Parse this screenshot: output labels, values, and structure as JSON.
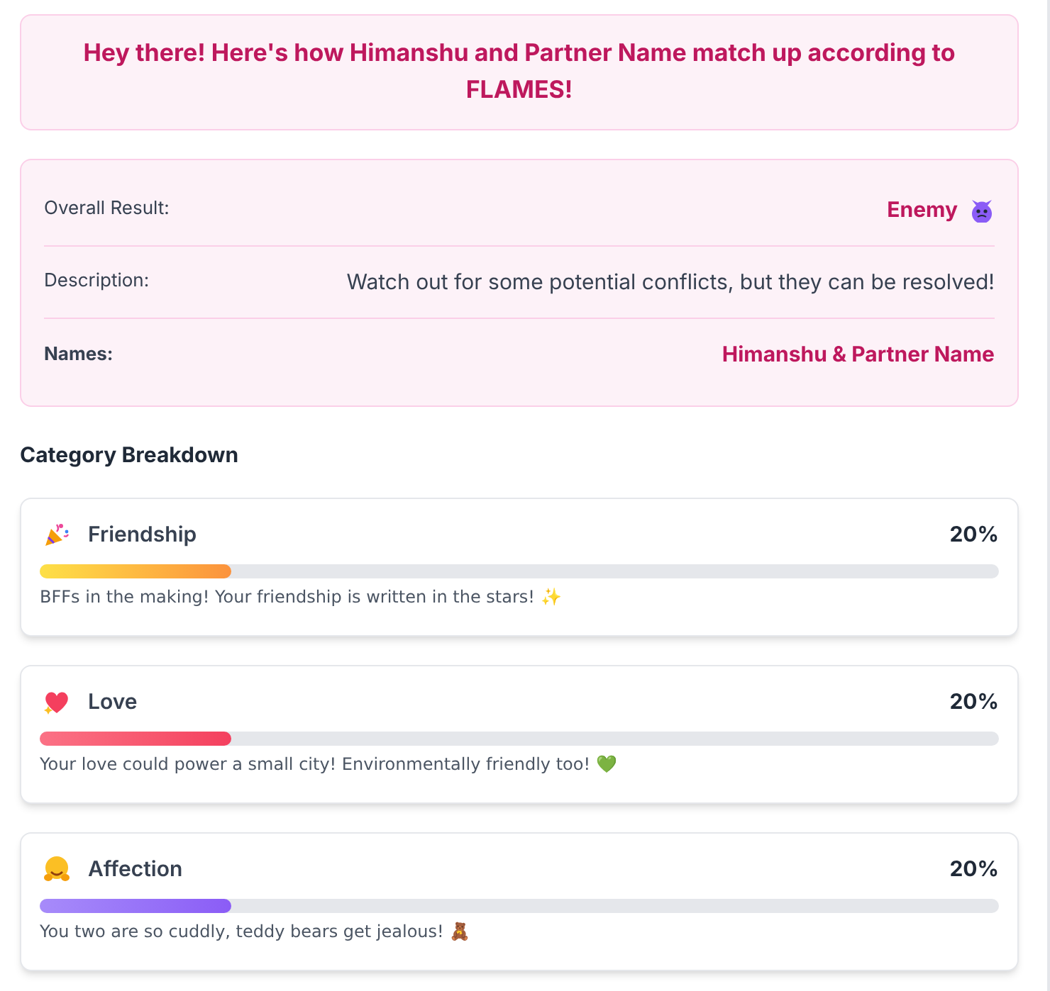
{
  "header": {
    "title": "Hey there! Here's how Himanshu and Partner Name match up according to FLAMES!"
  },
  "summary": {
    "rows": [
      {
        "kind": "result",
        "label": "Overall Result:",
        "value": "Enemy"
      },
      {
        "kind": "text",
        "label": "Description:",
        "value": "Watch out for some potential conflicts, but they can be resolved!"
      },
      {
        "kind": "names",
        "label": "Names:",
        "value": "Himanshu & Partner Name"
      }
    ]
  },
  "breakdown": {
    "heading": "Category Breakdown",
    "categories": [
      {
        "kind": "friendship",
        "name": "Friendship",
        "percent": "20%",
        "level": 0.2,
        "note": "BFFs in the making! Your friendship is written in the stars! ✨"
      },
      {
        "kind": "love",
        "name": "Love",
        "percent": "20%",
        "level": 0.2,
        "note": "Your love could power a small city! Environmentally friendly too! 💚"
      },
      {
        "kind": "affection",
        "name": "Affection",
        "percent": "20%",
        "level": 0.2,
        "note": "You two are so cuddly, teddy bears get jealous! 🧸"
      }
    ]
  }
}
